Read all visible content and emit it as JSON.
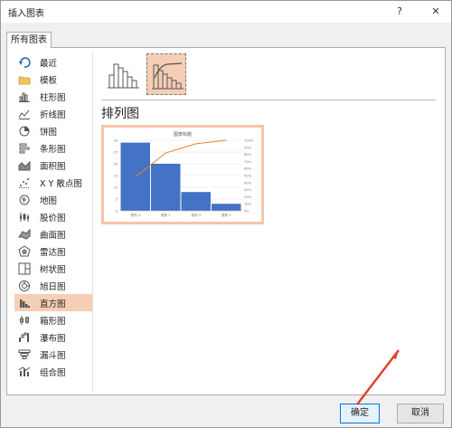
{
  "window": {
    "title": "插入图表",
    "help_label": "?",
    "close_label": "✕"
  },
  "tabs": [
    {
      "label": "所有图表"
    }
  ],
  "sidebar": {
    "items": [
      {
        "label": "最近",
        "icon": "recent-icon"
      },
      {
        "label": "模板",
        "icon": "folder-icon"
      },
      {
        "label": "柱形图",
        "icon": "column-chart-icon"
      },
      {
        "label": "折线图",
        "icon": "line-chart-icon"
      },
      {
        "label": "饼图",
        "icon": "pie-chart-icon"
      },
      {
        "label": "条形图",
        "icon": "bar-chart-icon"
      },
      {
        "label": "面积图",
        "icon": "area-chart-icon"
      },
      {
        "label": "X Y 散点图",
        "icon": "scatter-chart-icon"
      },
      {
        "label": "地图",
        "icon": "map-chart-icon"
      },
      {
        "label": "股价图",
        "icon": "stock-chart-icon"
      },
      {
        "label": "曲面图",
        "icon": "surface-chart-icon"
      },
      {
        "label": "雷达图",
        "icon": "radar-chart-icon"
      },
      {
        "label": "树状图",
        "icon": "treemap-chart-icon"
      },
      {
        "label": "旭日图",
        "icon": "sunburst-chart-icon"
      },
      {
        "label": "直方图",
        "icon": "histogram-chart-icon",
        "selected": true
      },
      {
        "label": "箱形图",
        "icon": "box-whisker-chart-icon"
      },
      {
        "label": "瀑布图",
        "icon": "waterfall-chart-icon"
      },
      {
        "label": "漏斗图",
        "icon": "funnel-chart-icon"
      },
      {
        "label": "组合图",
        "icon": "combo-chart-icon"
      }
    ]
  },
  "subtypes": [
    {
      "icon": "histogram-subtype-icon",
      "selected": false
    },
    {
      "icon": "pareto-subtype-icon",
      "selected": true
    }
  ],
  "selected_subtype_title": "排列图",
  "chart_data": {
    "type": "bar",
    "title": "图表标题",
    "categories": [
      "类别 4",
      "类别 1",
      "类别 3",
      "类别 2"
    ],
    "series": [
      {
        "values": [
          29,
          20,
          8,
          3
        ]
      },
      {
        "type": "line",
        "values": [
          48,
          82,
          95,
          100
        ]
      }
    ],
    "ylim": [
      0,
      30
    ],
    "y_ticks": [
      "0",
      "5",
      "10",
      "15",
      "20",
      "25",
      "30"
    ],
    "y2lim": [
      0,
      100
    ],
    "y2_ticks": [
      "0%",
      "10%",
      "20%",
      "30%",
      "40%",
      "50%",
      "60%",
      "70%",
      "80%",
      "90%",
      "100%"
    ],
    "bar_color": "#4472c4",
    "line_color": "#ed7d31",
    "grid": true
  },
  "footer": {
    "ok_label": "确定",
    "cancel_label": "取消"
  },
  "colors": {
    "accent": "#f6cdb5",
    "highlight_border": "#f4c6a8",
    "arrow": "#e0402a"
  }
}
